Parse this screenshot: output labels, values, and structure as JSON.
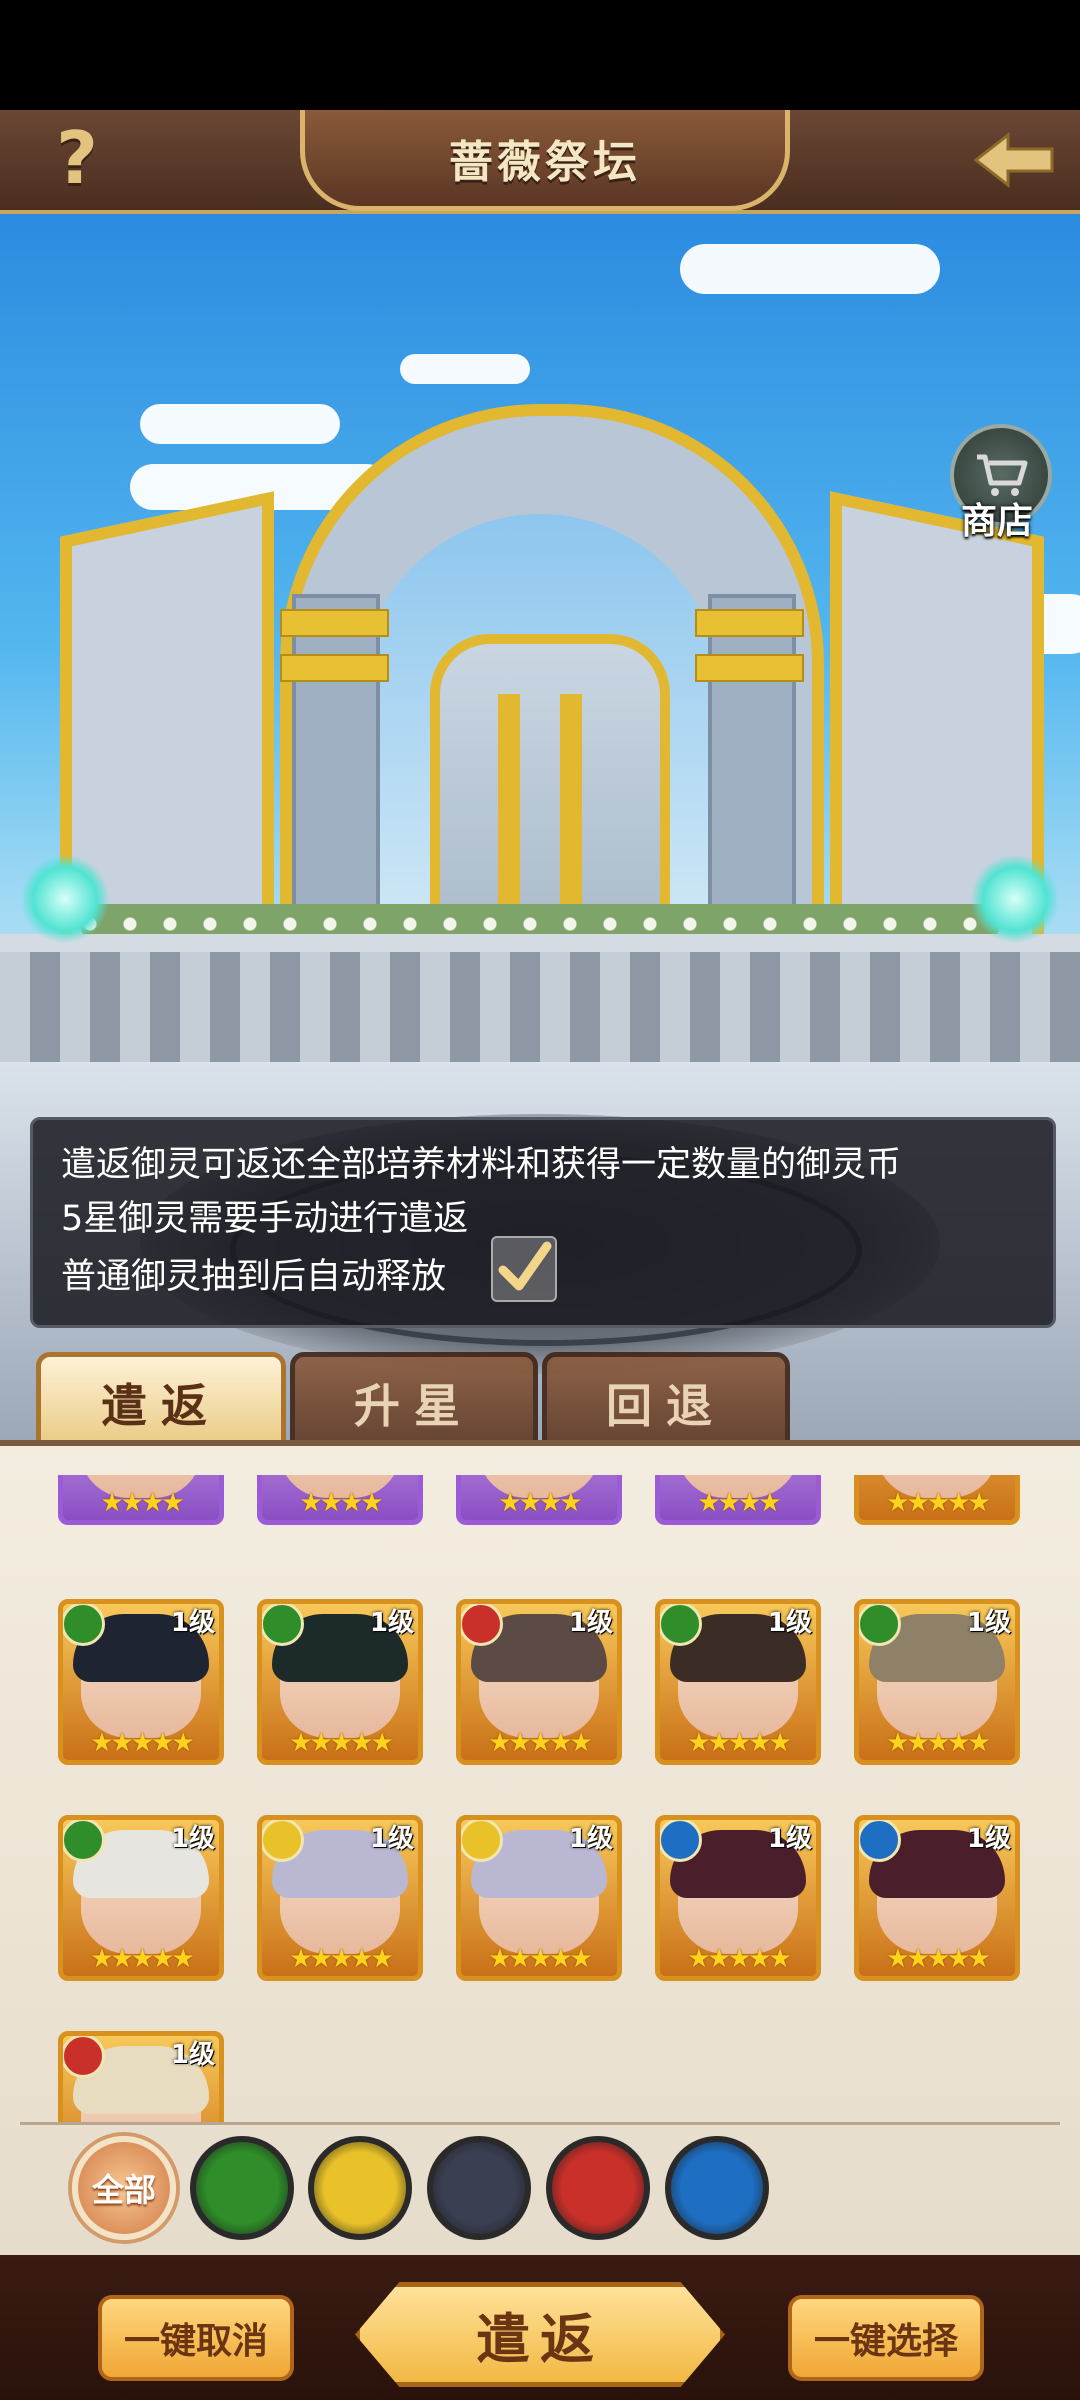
{
  "header": {
    "title": "蔷薇祭坛",
    "help_label": "?"
  },
  "shop": {
    "label": "商店"
  },
  "info": {
    "line1": "遣返御灵可返还全部培养材料和获得一定数量的御灵币",
    "line2": "5星御灵需要手动进行遣返",
    "line3": "普通御灵抽到后自动释放",
    "auto_release_checked": true
  },
  "tabs": [
    {
      "label": "遣返",
      "active": true
    },
    {
      "label": "升星",
      "active": false
    },
    {
      "label": "回退",
      "active": false
    }
  ],
  "cards": [
    {
      "level": "",
      "stars": "★★★★",
      "element": "",
      "frame": "purple"
    },
    {
      "level": "",
      "stars": "★★★★",
      "element": "",
      "frame": "purple"
    },
    {
      "level": "",
      "stars": "★★★★",
      "element": "",
      "frame": "purple"
    },
    {
      "level": "",
      "stars": "★★★★",
      "element": "",
      "frame": "purple"
    },
    {
      "level": "",
      "stars": "★★★★★",
      "element": "",
      "frame": "gold"
    },
    {
      "level": "1级",
      "stars": "★★★★★",
      "element": "wind-green",
      "frame": "gold"
    },
    {
      "level": "1级",
      "stars": "★★★★★",
      "element": "wind-green",
      "frame": "gold"
    },
    {
      "level": "1级",
      "stars": "★★★★★",
      "element": "fire-red",
      "frame": "gold"
    },
    {
      "level": "1级",
      "stars": "★★★★★",
      "element": "wind-green",
      "frame": "gold"
    },
    {
      "level": "1级",
      "stars": "★★★★★",
      "element": "wind-green",
      "frame": "gold"
    },
    {
      "level": "1级",
      "stars": "★★★★★",
      "element": "wind-green",
      "frame": "gold"
    },
    {
      "level": "1级",
      "stars": "★★★★★",
      "element": "light-gold",
      "frame": "gold"
    },
    {
      "level": "1级",
      "stars": "★★★★★",
      "element": "light-gold",
      "frame": "gold"
    },
    {
      "level": "1级",
      "stars": "★★★★★",
      "element": "water-blue",
      "frame": "gold"
    },
    {
      "level": "1级",
      "stars": "★★★★★",
      "element": "water-blue",
      "frame": "gold"
    },
    {
      "level": "1级",
      "stars": "",
      "element": "fire-red",
      "frame": "gold"
    }
  ],
  "filters": {
    "all_label": "全部",
    "items": [
      "wind-green",
      "light-gold",
      "dark-star",
      "fire-red",
      "water-blue"
    ]
  },
  "actions": {
    "cancel_all": "一键取消",
    "dismiss": "遣返",
    "select_all": "一键选择"
  },
  "colors": {
    "wind-green": "#2f8d2a",
    "light-gold": "#e9c229",
    "dark-star": "#3b3f52",
    "fire-red": "#c9302a",
    "water-blue": "#1e6fc4"
  }
}
